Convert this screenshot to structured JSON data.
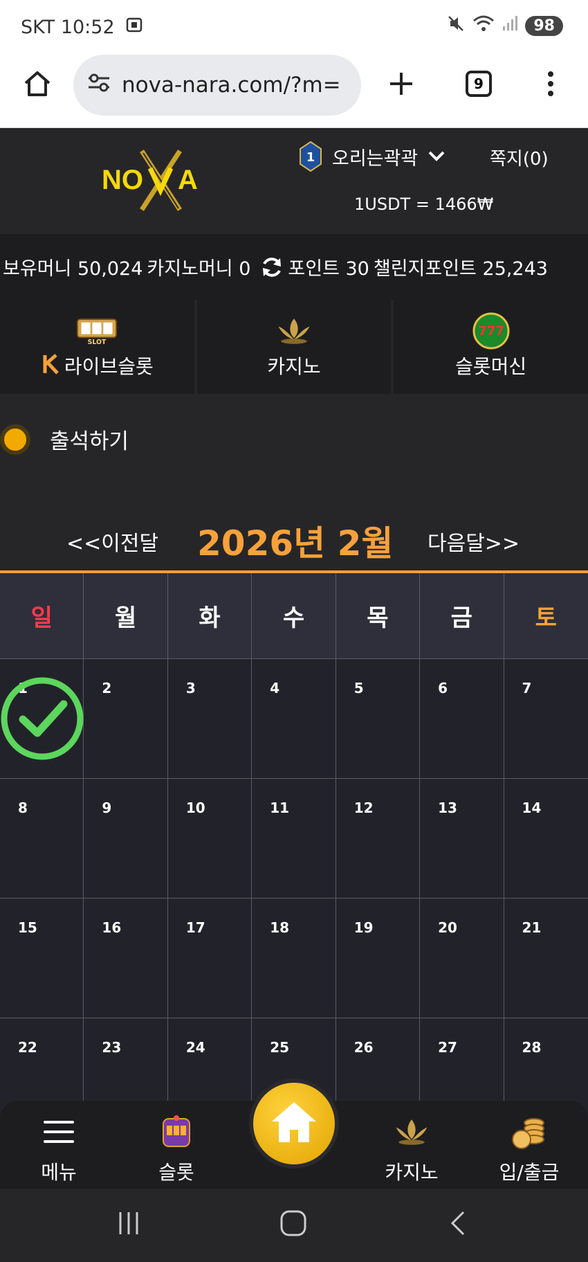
{
  "status_bar": {
    "carrier_time": "SKT 10:52",
    "battery": "98"
  },
  "browser": {
    "url": "nova-nara.com/?m=",
    "tab_count": "9"
  },
  "header": {
    "logo_text": "NOVA",
    "level": "1",
    "username": "오리는곽곽",
    "memo_label": "쪽지(0)",
    "exchange_rate": "1USDT = 1466₩"
  },
  "money_bar": {
    "balance": "보유머니 50,024",
    "casino_money": "카지노머니 0",
    "points": "포인트 30",
    "challenge_points": "챌린지포인트 25,243"
  },
  "categories": [
    {
      "label": "라이브슬롯",
      "icon": "live-slot-icon"
    },
    {
      "label": "카지노",
      "icon": "kslot-lotus-icon"
    },
    {
      "label": "슬롯머신",
      "icon": "777-slots-icon"
    }
  ],
  "attendance": {
    "title": "출석하기"
  },
  "calendar": {
    "prev_label": "<<이전달",
    "title": "2026년 2월",
    "next_label": "다음달>>",
    "weekdays": [
      "일",
      "월",
      "화",
      "수",
      "목",
      "금",
      "토"
    ],
    "weeks": [
      [
        "1",
        "2",
        "3",
        "4",
        "5",
        "6",
        "7"
      ],
      [
        "8",
        "9",
        "10",
        "11",
        "12",
        "13",
        "14"
      ],
      [
        "15",
        "16",
        "17",
        "18",
        "19",
        "20",
        "21"
      ],
      [
        "22",
        "23",
        "24",
        "25",
        "26",
        "27",
        "28"
      ]
    ],
    "checked_days": [
      "1"
    ]
  },
  "bottom_nav": {
    "menu": "메뉴",
    "slot": "슬롯",
    "casino": "카지노",
    "deposit": "입/출금"
  },
  "colors": {
    "accent": "#f7a13a",
    "sunday": "#ff3b4e",
    "saturday": "#f7a13a",
    "check": "#5cd65c"
  }
}
